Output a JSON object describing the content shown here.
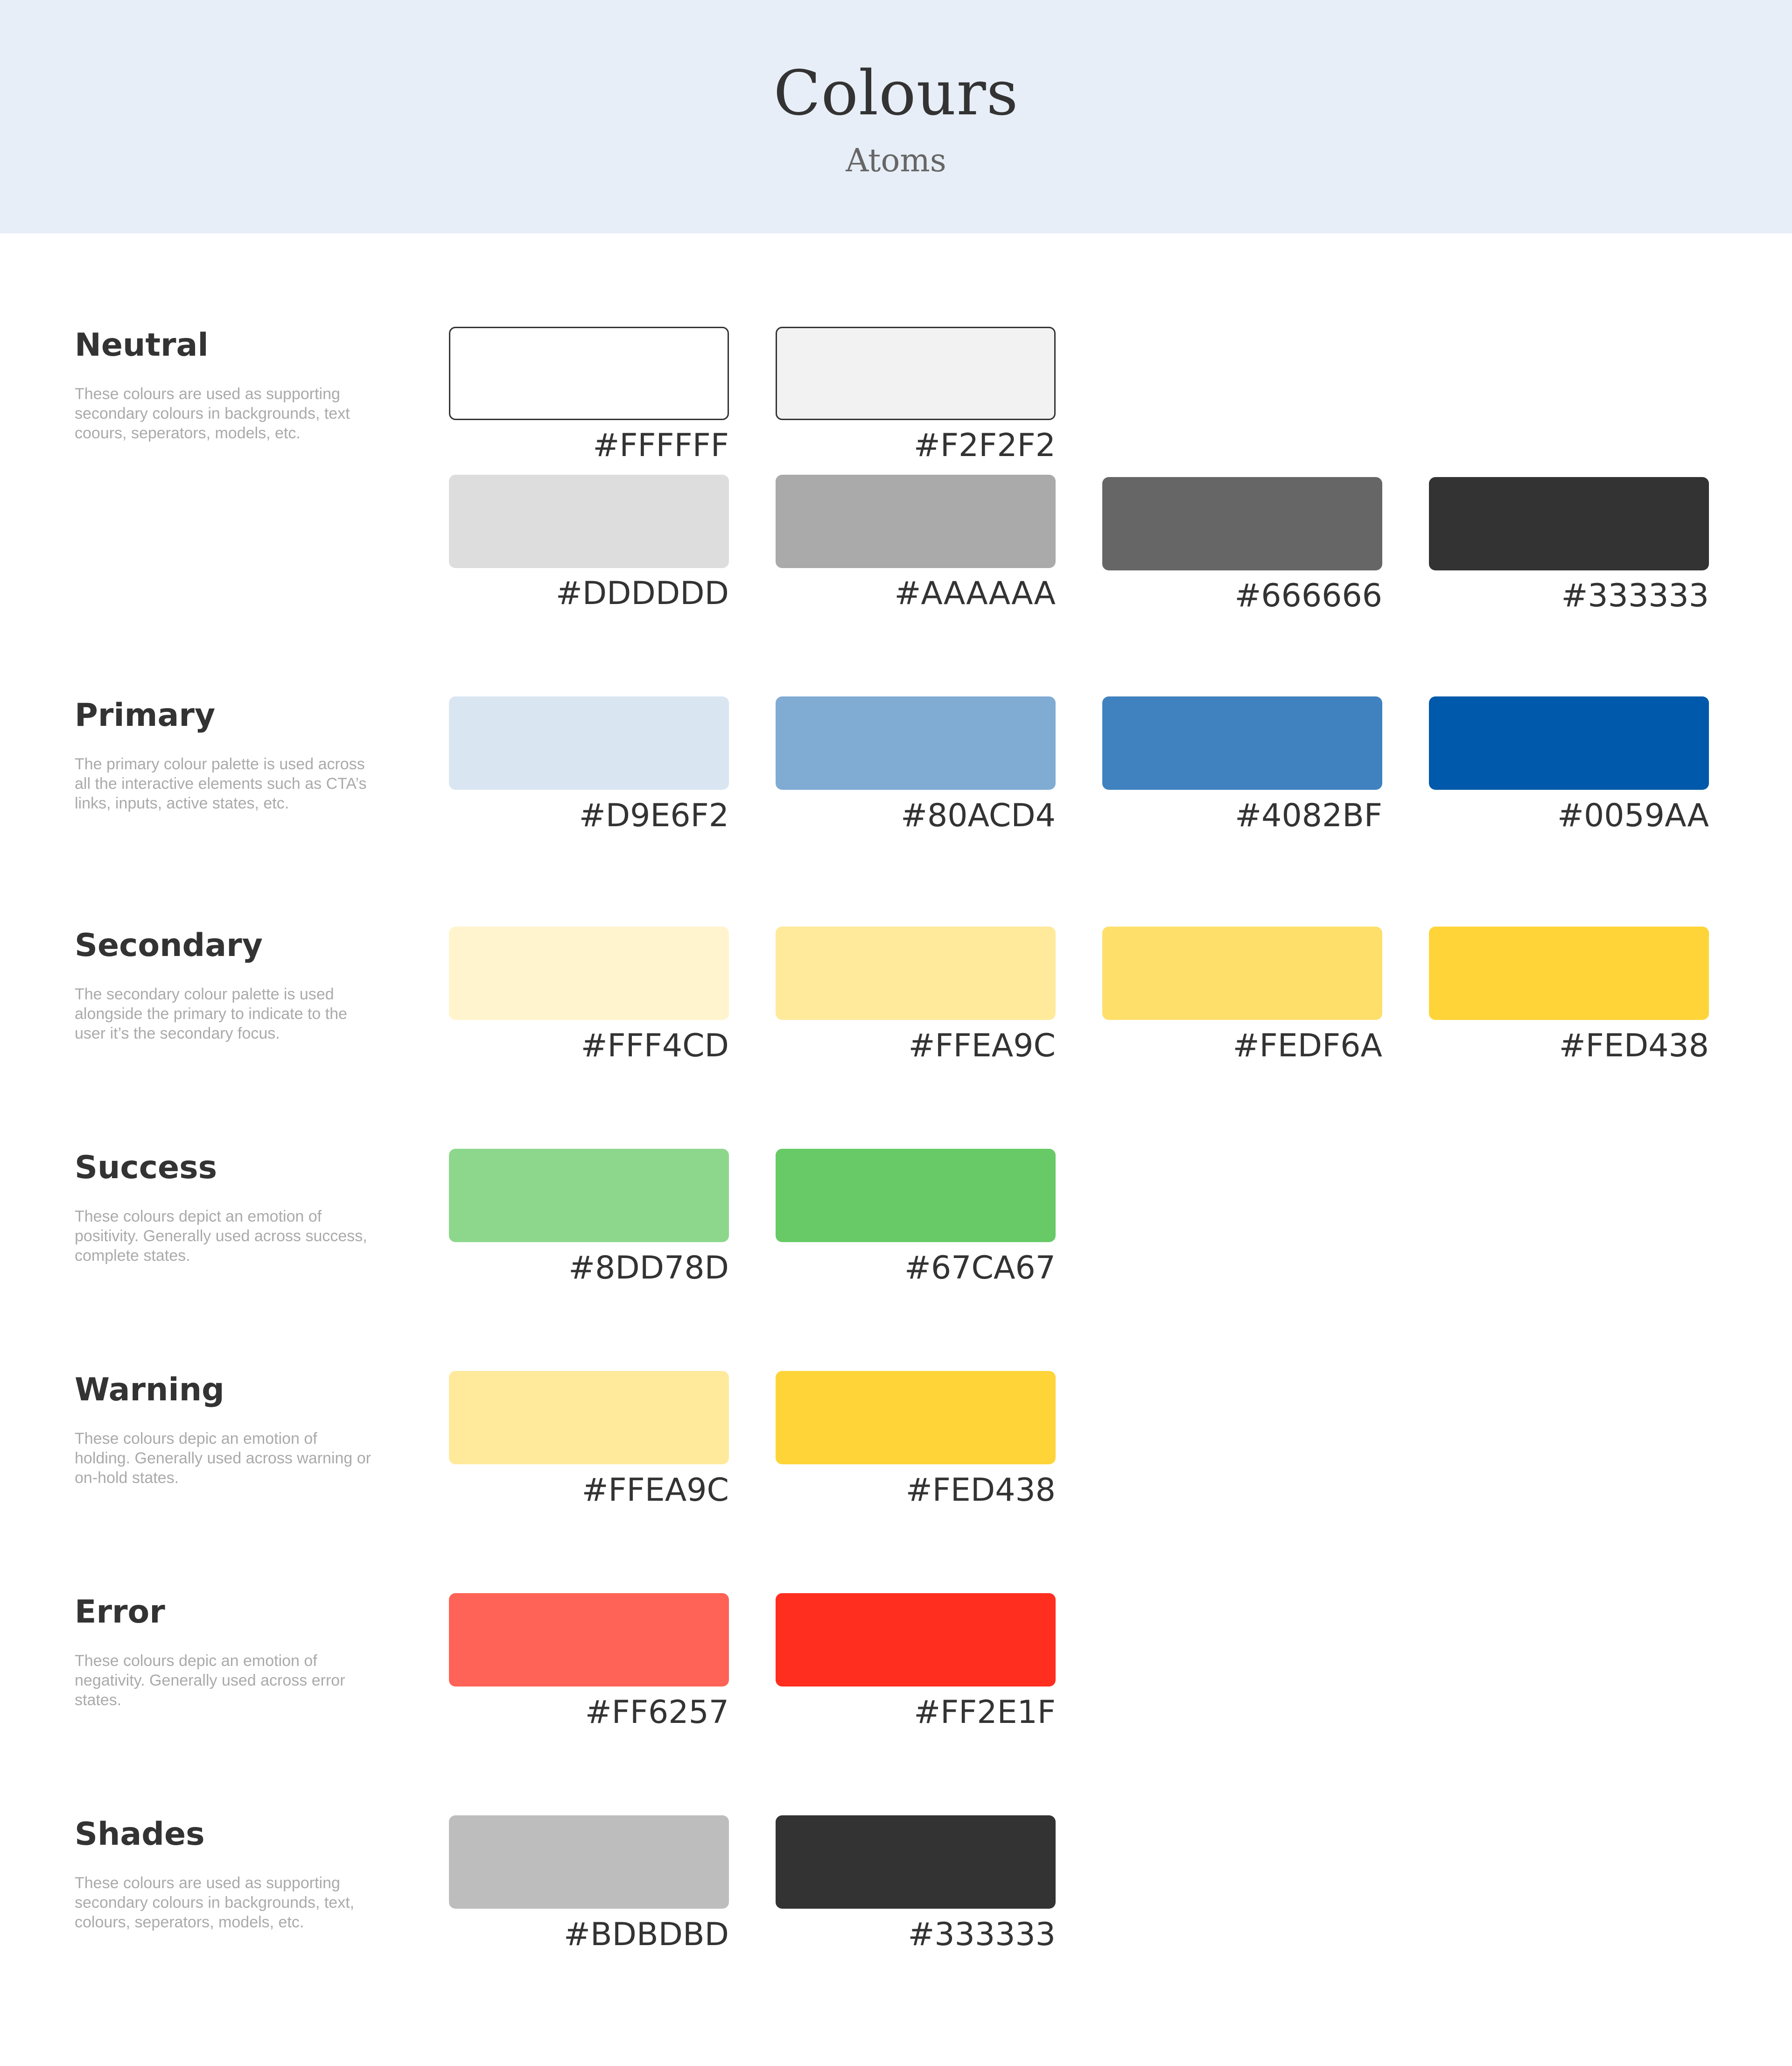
{
  "header": {
    "title": "Colours",
    "subtitle": "Atoms"
  },
  "sections": {
    "neutral": {
      "title": "Neutral",
      "description": "These colours are used as supporting secondary colours in backgrounds, text coours, seperators, models, etc.",
      "swatches": [
        {
          "hex": "#FFFFFF",
          "label": "#FFFFFF"
        },
        {
          "hex": "#F2F2F2",
          "label": "#F2F2F2"
        },
        {
          "hex": "#DDDDDD",
          "label": "#DDDDDD"
        },
        {
          "hex": "#AAAAAA",
          "label": "#AAAAAA"
        },
        {
          "hex": "#666666",
          "label": "#666666"
        },
        {
          "hex": "#333333",
          "label": "#333333"
        }
      ]
    },
    "primary": {
      "title": "Primary",
      "description": "The primary colour palette is used across all the interactive elements such as CTA’s links, inputs, active states, etc.",
      "swatches": [
        {
          "hex": "#D9E6F2",
          "label": "#D9E6F2"
        },
        {
          "hex": "#80ACD4",
          "label": "#80ACD4"
        },
        {
          "hex": "#4082BF",
          "label": "#4082BF"
        },
        {
          "hex": "#0059AA",
          "label": "#0059AA"
        }
      ]
    },
    "secondary": {
      "title": "Secondary",
      "description": "The secondary colour palette is used alongside the primary to indicate to the user it’s the secondary focus.",
      "swatches": [
        {
          "hex": "#FFF4CD",
          "label": "#FFF4CD"
        },
        {
          "hex": "#FFEA9C",
          "label": "#FFEA9C"
        },
        {
          "hex": "#FEDF6A",
          "label": "#FEDF6A"
        },
        {
          "hex": "#FED438",
          "label": "#FED438"
        }
      ]
    },
    "success": {
      "title": "Success",
      "description": "These colours depict an emotion of positivity. Generally used across success, complete states.",
      "swatches": [
        {
          "hex": "#8DD78D",
          "label": "#8DD78D"
        },
        {
          "hex": "#67CA67",
          "label": "#67CA67"
        }
      ]
    },
    "warning": {
      "title": "Warning",
      "description": "These colours depic an emotion of holding. Generally used across warning or on-hold states.",
      "swatches": [
        {
          "hex": "#FFEA9C",
          "label": "#FFEA9C"
        },
        {
          "hex": "#FED438",
          "label": "#FED438"
        }
      ]
    },
    "error": {
      "title": "Error",
      "description": "These colours depic an emotion of negativity. Generally used across error states.",
      "swatches": [
        {
          "hex": "#FF6257",
          "label": "#FF6257"
        },
        {
          "hex": "#FF2E1F",
          "label": "#FF2E1F"
        }
      ]
    },
    "shades": {
      "title": "Shades",
      "description": "These colours are used as supporting secondary colours in backgrounds, text, colours, seperators, models, etc.",
      "swatches": [
        {
          "hex": "#BDBDBD",
          "label": "#BDBDBD"
        },
        {
          "hex": "#333333",
          "label": "#333333"
        }
      ]
    }
  }
}
